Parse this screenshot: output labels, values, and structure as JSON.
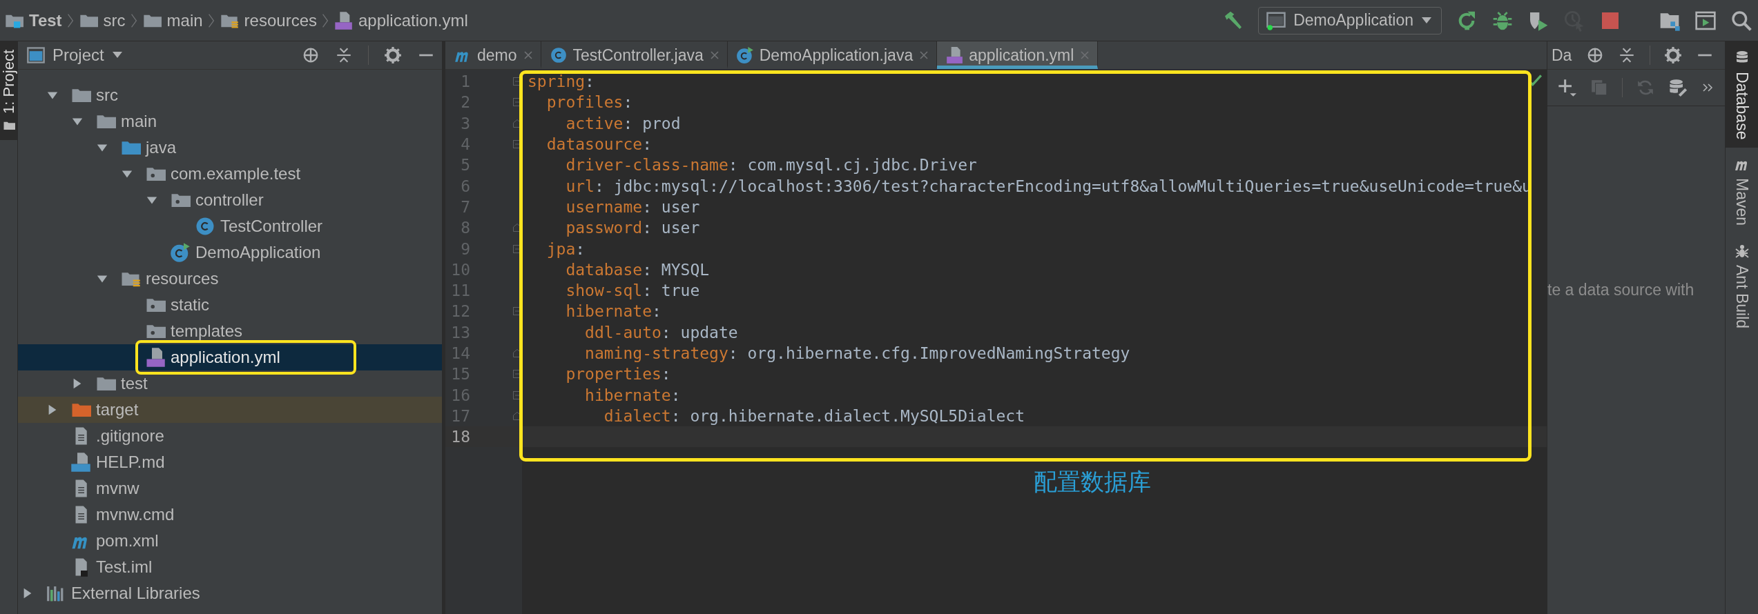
{
  "breadcrumbs": [
    {
      "label": "Test",
      "kind": "project"
    },
    {
      "label": "src",
      "kind": "folder"
    },
    {
      "label": "main",
      "kind": "folder"
    },
    {
      "label": "resources",
      "kind": "resources-folder"
    },
    {
      "label": "application.yml",
      "kind": "yml"
    }
  ],
  "toolbar": {
    "run_config": "DemoApplication",
    "actions": [
      {
        "kind": "build",
        "disabled": false
      },
      {
        "kind": "rerun",
        "disabled": false
      },
      {
        "kind": "debug",
        "disabled": false
      },
      {
        "kind": "coverage",
        "disabled": false
      },
      {
        "kind": "profile",
        "disabled": true
      },
      {
        "kind": "stop",
        "disabled": false
      },
      {
        "kind": "project-structure",
        "disabled": false
      },
      {
        "kind": "terminal",
        "disabled": false
      },
      {
        "kind": "search",
        "disabled": false
      }
    ]
  },
  "left_stripe": [
    {
      "label": "1: Project",
      "selected": true
    }
  ],
  "project_panel": {
    "title": "Project",
    "tree": [
      {
        "label": "src",
        "kind": "folder",
        "selected": false,
        "expanded": true,
        "children": [
          {
            "label": "main",
            "kind": "folder",
            "selected": false,
            "expanded": true,
            "children": [
              {
                "label": "java",
                "kind": "source-folder",
                "selected": false,
                "expanded": true,
                "children": [
                  {
                    "label": "com.example.test",
                    "kind": "package",
                    "selected": false,
                    "expanded": true,
                    "children": [
                      {
                        "label": "controller",
                        "kind": "package",
                        "selected": false,
                        "expanded": true,
                        "children": [
                          {
                            "label": "TestController",
                            "kind": "class",
                            "selected": false
                          }
                        ]
                      },
                      {
                        "label": "DemoApplication",
                        "kind": "main-class",
                        "selected": false
                      }
                    ]
                  }
                ]
              },
              {
                "label": "resources",
                "kind": "resources-folder",
                "selected": false,
                "expanded": true,
                "children": [
                  {
                    "label": "static",
                    "kind": "package",
                    "selected": false
                  },
                  {
                    "label": "templates",
                    "kind": "package",
                    "selected": false
                  },
                  {
                    "label": "application.yml",
                    "kind": "yml",
                    "selected": true
                  }
                ]
              }
            ]
          },
          {
            "label": "test",
            "kind": "folder",
            "selected": false,
            "expanded": false
          }
        ]
      },
      {
        "label": "target",
        "kind": "excluded-folder",
        "selected": false,
        "expanded": false
      },
      {
        "label": ".gitignore",
        "kind": "file",
        "selected": false
      },
      {
        "label": "HELP.md",
        "kind": "md",
        "selected": false
      },
      {
        "label": "mvnw",
        "kind": "file",
        "selected": false
      },
      {
        "label": "mvnw.cmd",
        "kind": "file",
        "selected": false
      },
      {
        "label": "pom.xml",
        "kind": "maven",
        "selected": false
      },
      {
        "label": "Test.iml",
        "kind": "iml",
        "selected": false
      }
    ],
    "external_libraries": {
      "label": "External Libraries",
      "expanded": false
    }
  },
  "editor": {
    "tabs": [
      {
        "label": "demo",
        "kind": "maven",
        "selected": false
      },
      {
        "label": "TestController.java",
        "kind": "class",
        "selected": false
      },
      {
        "label": "DemoApplication.java",
        "kind": "main-class",
        "selected": false
      },
      {
        "label": "application.yml",
        "kind": "yml",
        "selected": true
      }
    ],
    "lines": [
      {
        "number": "1",
        "key": "spring",
        "colon": ":",
        "kind": "fold-start",
        "current": false,
        "children": [
          {
            "number": "2",
            "key": "profiles",
            "colon": ":",
            "kind": "fold-start",
            "current": false,
            "children": [
              {
                "number": "3",
                "key": "active",
                "colon": ":",
                "value": "prod",
                "kind": "fold-end",
                "current": false
              }
            ]
          },
          {
            "number": "4",
            "key": "datasource",
            "colon": ":",
            "kind": "fold-start",
            "current": false,
            "children": [
              {
                "number": "5",
                "key": "driver-class-name",
                "colon": ":",
                "value": "com.mysql.cj.jdbc.Driver",
                "kind": "plain",
                "current": false
              },
              {
                "number": "6",
                "key": "url",
                "colon": ":",
                "value": "jdbc:mysql://localhost:3306/test?characterEncoding=utf8&allowMultiQueries=true&useUnicode=true&u",
                "kind": "plain",
                "current": false
              },
              {
                "number": "7",
                "key": "username",
                "colon": ":",
                "value": "user",
                "kind": "plain",
                "current": false
              },
              {
                "number": "8",
                "key": "password",
                "colon": ":",
                "value": "user",
                "kind": "fold-end",
                "current": false
              }
            ]
          },
          {
            "number": "9",
            "key": "jpa",
            "colon": ":",
            "kind": "fold-start",
            "current": false,
            "children": [
              {
                "number": "10",
                "key": "database",
                "colon": ":",
                "value": "MYSQL",
                "kind": "plain",
                "current": false
              },
              {
                "number": "11",
                "key": "show-sql",
                "colon": ":",
                "value": "true",
                "kind": "plain",
                "current": false
              },
              {
                "number": "12",
                "key": "hibernate",
                "colon": ":",
                "kind": "fold-start",
                "current": false,
                "children": [
                  {
                    "number": "13",
                    "key": "ddl-auto",
                    "colon": ":",
                    "value": "update",
                    "kind": "plain",
                    "current": false
                  },
                  {
                    "number": "14",
                    "key": "naming-strategy",
                    "colon": ":",
                    "value": "org.hibernate.cfg.ImprovedNamingStrategy",
                    "kind": "fold-end",
                    "current": false
                  }
                ]
              },
              {
                "number": "15",
                "key": "properties",
                "colon": ":",
                "kind": "fold-start",
                "current": false,
                "children": [
                  {
                    "number": "16",
                    "key": "hibernate",
                    "colon": ":",
                    "kind": "fold-start",
                    "current": false,
                    "children": [
                      {
                        "number": "17",
                        "key": "dialect",
                        "colon": ":",
                        "value": "org.hibernate.dialect.MySQL5Dialect",
                        "kind": "fold-end",
                        "current": false
                      }
                    ]
                  }
                ]
              }
            ]
          }
        ]
      },
      {
        "number": "18",
        "kind": "plain",
        "current": true
      }
    ],
    "annotation": "配置数据库"
  },
  "database_panel": {
    "title": "Da",
    "hint": "te a data source with"
  },
  "right_stripe": [
    {
      "label": "Database",
      "kind": "database",
      "selected": true
    },
    {
      "label": "Maven",
      "kind": "maven",
      "selected": false
    },
    {
      "label": "Ant Build",
      "kind": "ant",
      "selected": false
    }
  ]
}
